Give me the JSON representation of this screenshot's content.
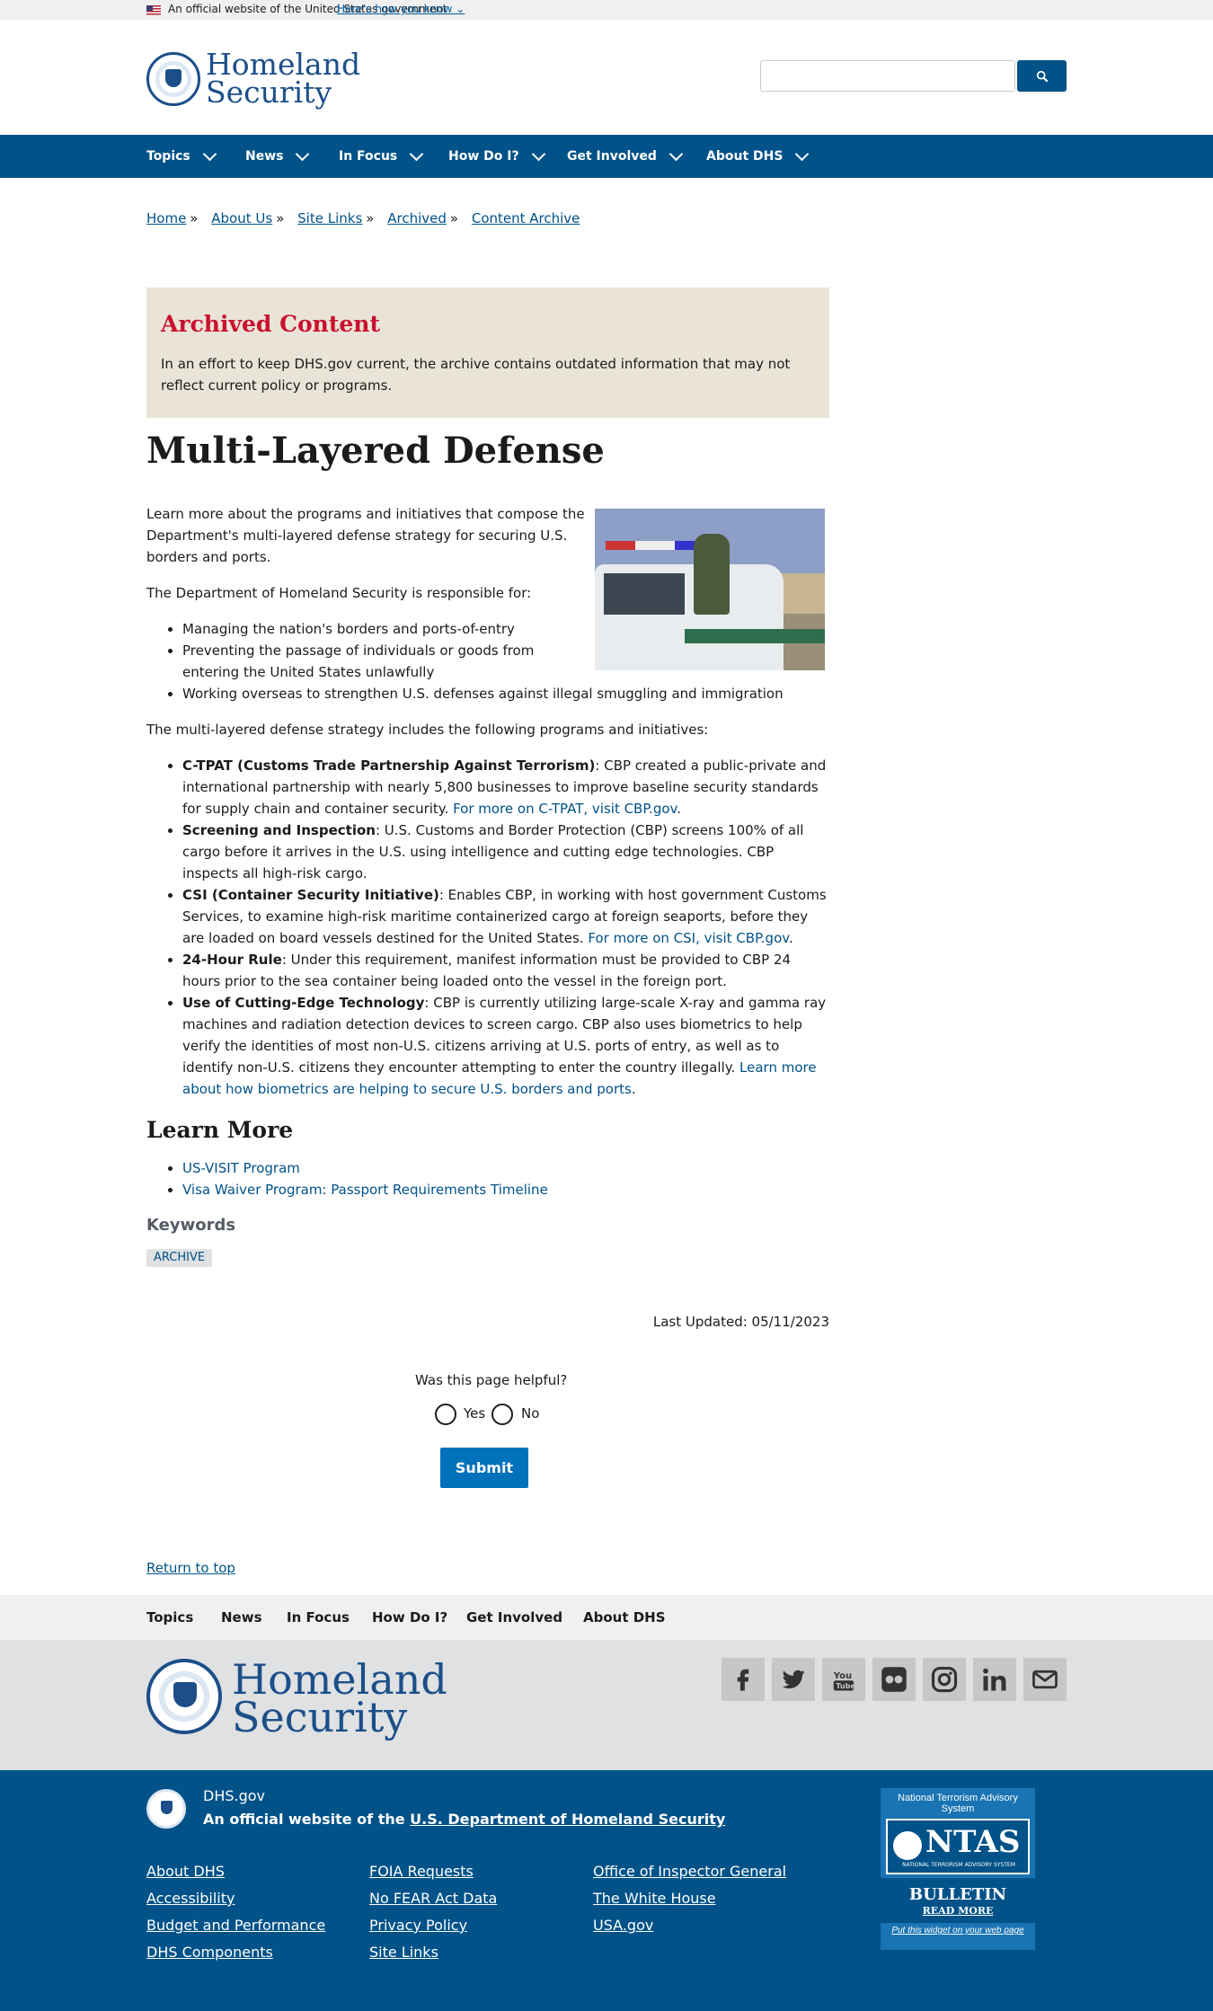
{
  "banner": {
    "text": "An official website of the United States government",
    "how_link": "Here’s how you know ⌄"
  },
  "header": {
    "logo_line1": "Homeland",
    "logo_line2": "Security",
    "search_placeholder": ""
  },
  "nav": {
    "items": [
      "Topics",
      "News",
      "In Focus",
      "How Do I?",
      "Get Involved",
      "About DHS"
    ]
  },
  "breadcrumb": [
    "Home",
    "About Us",
    "Site Links",
    "Archived",
    "Content Archive"
  ],
  "breadcrumb_sep": "»",
  "archived": {
    "title": "Archived Content",
    "text": "In an effort to keep DHS.gov current, the archive contains outdated information that may not reflect current policy or programs."
  },
  "page_title": "Multi-Layered Defense",
  "content": {
    "intro": "Learn more about the programs and initiatives that compose the Department's multi-layered defense strategy for securing U.S. borders and ports.",
    "responsible": "The Department of Homeland Security is responsible for:",
    "responsibilities": [
      "Managing the nation's borders and ports-of-entry",
      "Preventing the passage of individuals or goods from entering the United States unlawfully",
      "Working overseas to strengthen U.S. defenses against illegal smuggling and immigration"
    ],
    "strategy_intro": "The multi-layered defense strategy includes the following programs and initiatives:",
    "programs": [
      {
        "name": "C-TPAT (Customs Trade Partnership Against Terrorism)",
        "text": ": CBP created a public-private and international partnership with nearly 5,800 businesses to improve baseline security standards for supply chain and container security. ",
        "link": "For more on C-TPAT, visit CBP.gov",
        "after": "."
      },
      {
        "name": "Screening and Inspection",
        "text": ": U.S. Customs and Border Protection (CBP) screens 100% of all cargo before it arrives in the U.S. using intelligence and cutting edge technologies. CBP inspects all high-risk cargo.",
        "link": "",
        "after": ""
      },
      {
        "name": "CSI (Container Security Initiative)",
        "text": ": Enables CBP, in working with host government Customs Services, to examine high-risk maritime containerized cargo at foreign seaports, before they are loaded on board vessels destined for the United States. ",
        "link": "For more on CSI, visit CBP.gov",
        "after": "."
      },
      {
        "name": "24-Hour Rule",
        "text": ": Under this requirement, manifest information must be provided to CBP 24 hours prior to the sea container being loaded onto the vessel in the foreign port.",
        "link": "",
        "after": ""
      },
      {
        "name": "Use of Cutting-Edge Technology",
        "text": ": CBP is currently utilizing large-scale X-ray and gamma ray machines and radiation detection devices to screen cargo. CBP also uses biometrics to help verify the identities of most non-U.S. citizens arriving at U.S. ports of entry, as well as to identify non-U.S. citizens they encounter attempting to enter the country illegally. ",
        "link": "Learn more about how biometrics are helping to secure U.S. borders and ports",
        "after": "."
      }
    ],
    "learn_more_heading": "Learn More",
    "learn_more_links": [
      "US-VISIT Program",
      "Visa Waiver Program: Passport Requirements Timeline"
    ],
    "keywords_heading": "Keywords",
    "keyword": "ARCHIVE"
  },
  "last_updated": "Last Updated: 05/11/2023",
  "feedback": {
    "question": "Was this page helpful?",
    "yes": "Yes",
    "no": "No",
    "submit": "Submit"
  },
  "return_top": "Return to top",
  "footer_nav": [
    "Topics",
    "News",
    "In Focus",
    "How Do I?",
    "Get Involved",
    "About DHS"
  ],
  "footer_logo": {
    "line1": "Homeland",
    "line2": "Security"
  },
  "social_icons": [
    "facebook-icon",
    "twitter-icon",
    "youtube-icon",
    "flickr-icon",
    "instagram-icon",
    "linkedin-icon",
    "email-icon"
  ],
  "footer": {
    "site": "DHS.gov",
    "official_prefix": "An official website of the ",
    "official_link": "U.S. Department of Homeland Security",
    "links_col1": [
      "About DHS",
      "Accessibility",
      "Budget and Performance",
      "DHS Components"
    ],
    "links_col2": [
      "FOIA Requests",
      "No FEAR Act Data",
      "Privacy Policy",
      "Site Links"
    ],
    "links_col3": [
      "Office of Inspector General",
      "The White House",
      "USA.gov"
    ]
  },
  "ntas": {
    "title": "National Terrorism Advisory System",
    "word": "NTAS",
    "sub": "NATIONAL TERRORISM ADVISORY SYSTEM",
    "bulletin": "BULLETIN",
    "read_more": "READ MORE",
    "widget": "Put this widget on your web page"
  },
  "colors": {
    "primary": "#005288",
    "alert_title": "#c9102f",
    "archive_bg": "#e9e4d7",
    "submit": "#0071bb"
  }
}
